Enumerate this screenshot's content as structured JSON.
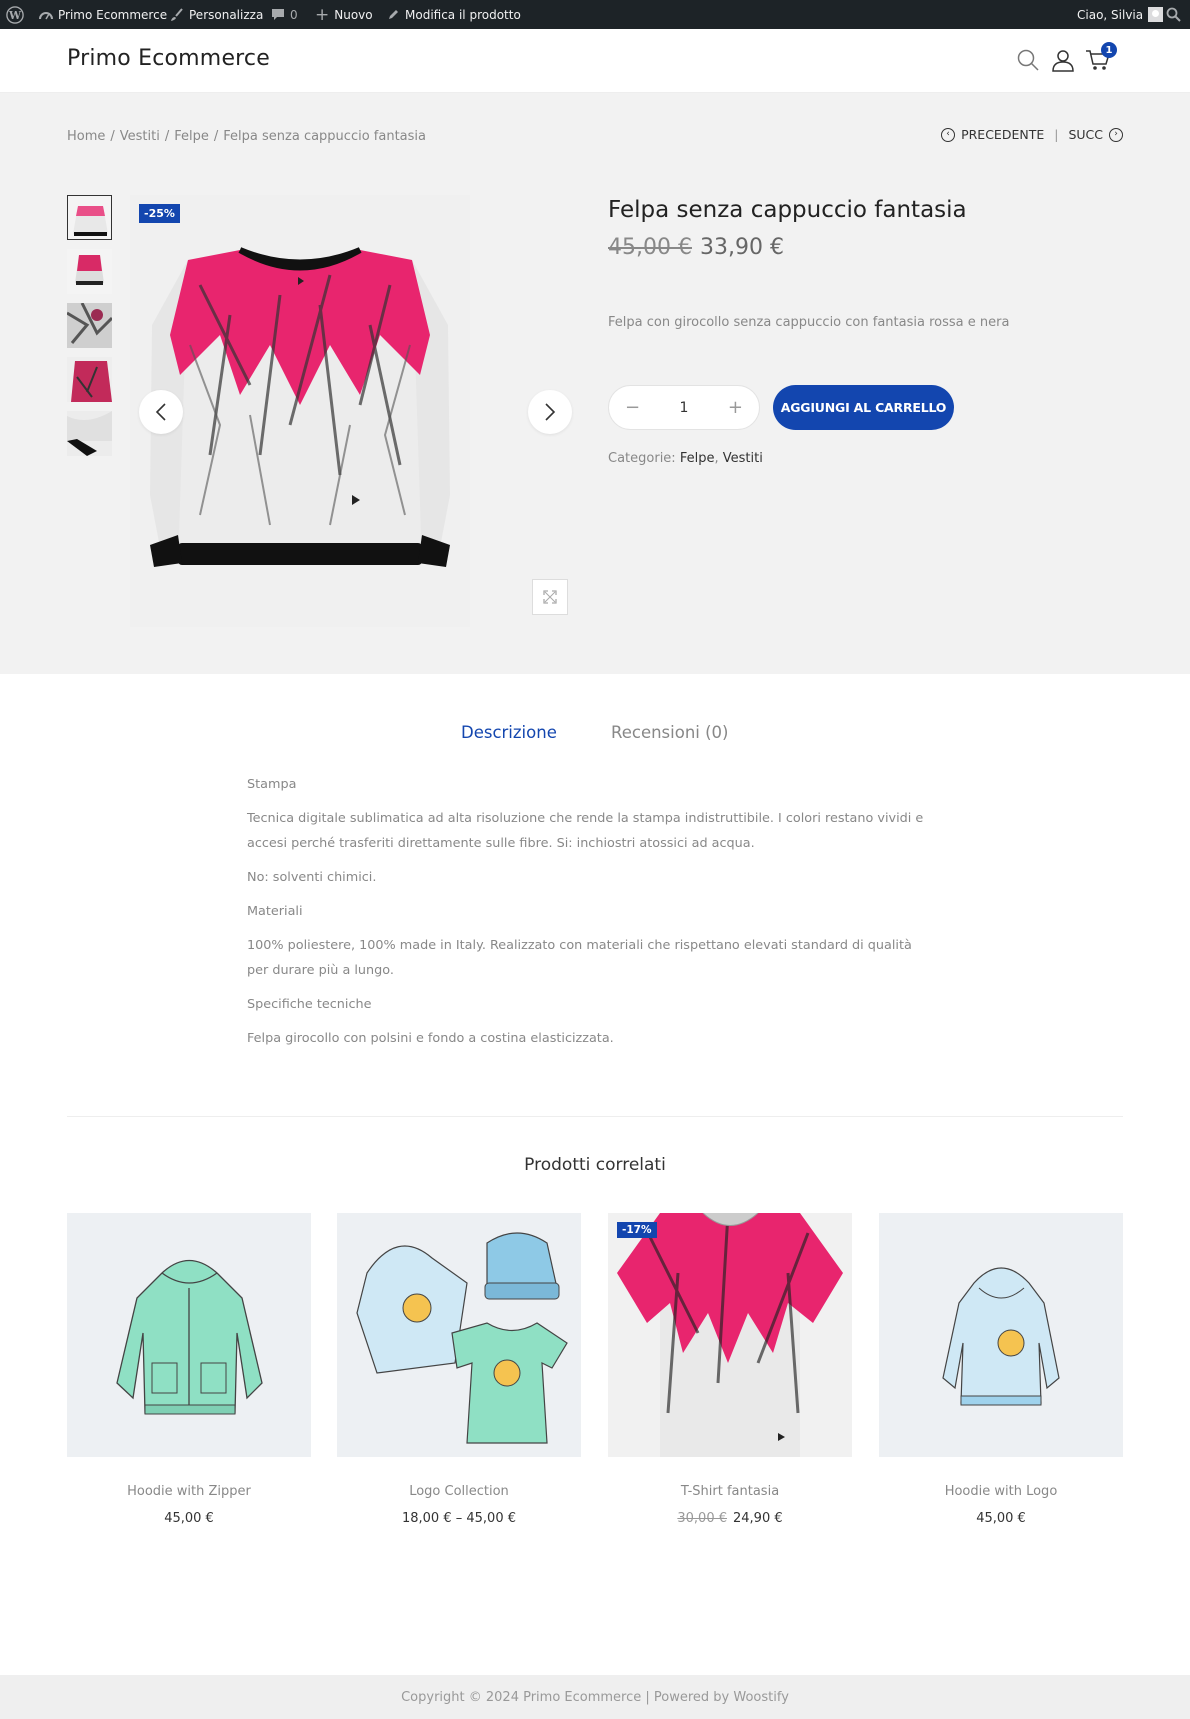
{
  "admin_bar": {
    "site_name": "Primo Ecommerce",
    "customize": "Personalizza",
    "comments_count": "0",
    "new": "Nuovo",
    "edit_product": "Modifica il prodotto",
    "greeting": "Ciao, Silvia"
  },
  "header": {
    "site_title": "Primo Ecommerce",
    "cart_count": "1"
  },
  "breadcrumb": [
    "Home",
    "Vestiti",
    "Felpe",
    "Felpa senza cappuccio fantasia"
  ],
  "product_nav": {
    "prev": "PRECEDENTE",
    "next": "SUCC"
  },
  "product": {
    "sale_badge": "-25%",
    "title": "Felpa senza cappuccio fantasia",
    "old_price": "45,00 €",
    "price": "33,90 €",
    "short_description": "Felpa con girocollo senza cappuccio con fantasia rossa e nera",
    "quantity": "1",
    "add_to_cart": "AGGIUNGI AL CARRELLO",
    "categories_label": "Categorie:",
    "categories": [
      "Felpe",
      "Vestiti"
    ]
  },
  "tabs": {
    "description": "Descrizione",
    "reviews": "Recensioni (0)"
  },
  "description": [
    "Stampa",
    "Tecnica digitale sublimatica ad alta risoluzione che rende la stampa indistruttibile. I colori restano vividi e accesi perché trasferiti direttamente sulle fibre. Si: inchiostri atossici ad acqua.",
    "No: solventi chimici.",
    "Materiali",
    "100% poliestere, 100% made in Italy. Realizzato con materiali che rispettano elevati standard di qualità per durare più a lungo.",
    "Specifiche tecniche",
    "Felpa girocollo con polsini e fondo a costina elasticizzata."
  ],
  "related": {
    "title": "Prodotti correlati",
    "items": [
      {
        "name": "Hoodie with Zipper",
        "price": "45,00 €"
      },
      {
        "name": "Logo Collection",
        "price": "18,00 € – 45,00 €"
      },
      {
        "name": "T-Shirt fantasia",
        "old_price": "30,00 €",
        "price": "24,90 €",
        "badge": "-17%"
      },
      {
        "name": "Hoodie with Logo",
        "price": "45,00 €"
      }
    ]
  },
  "footer": {
    "copyright": "Copyright © 2024 Primo Ecommerce | Powered by Woostify"
  },
  "colors": {
    "accent": "#1346af",
    "admin_bar_bg": "#1d2327",
    "section_bg": "#f2f2f2"
  }
}
